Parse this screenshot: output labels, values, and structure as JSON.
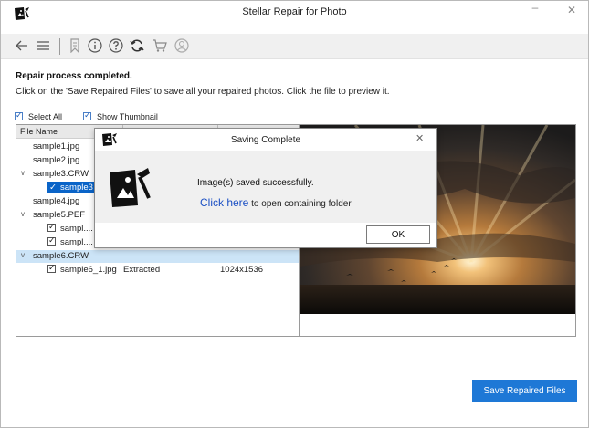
{
  "app": {
    "title": "Stellar Repair for Photo",
    "minimize": "–",
    "close": "✕"
  },
  "toolbar": {
    "icons": [
      "back-arrow-icon",
      "menu-icon",
      "bookmark-icon",
      "info-icon",
      "help-icon",
      "refresh-icon",
      "cart-icon",
      "user-icon"
    ]
  },
  "main": {
    "status": "Repair process completed.",
    "instruction": "Click on the 'Save Repaired Files' to save all your repaired photos. Click the file to preview it.",
    "select_all": "Select All",
    "show_thumbnail": "Show Thumbnail"
  },
  "file_list": {
    "header": {
      "file_name": "File Name"
    },
    "rows": [
      {
        "label": "sample1.jpg"
      },
      {
        "label": "sample2.jpg"
      },
      {
        "label": "sample3.CRW",
        "expander": "v"
      },
      {
        "label": "sample3"
      },
      {
        "label": "sample4.jpg"
      },
      {
        "label": "sample5.PEF",
        "expander": "v"
      },
      {
        "label": "sampl...."
      },
      {
        "label": "sampl...."
      },
      {
        "label": "sample6.CRW",
        "expander": "v"
      },
      {
        "label": "sample6_1.jpg",
        "status": "Extracted",
        "dimensions": "1024x1536"
      }
    ]
  },
  "save_button": "Save Repaired Files",
  "dialog": {
    "title": "Saving Complete",
    "close": "✕",
    "message": "Image(s) saved successfully.",
    "link_text": "Click here",
    "link_suffix": " to open containing folder.",
    "ok": "OK"
  },
  "colors": {
    "accent": "#1e78d6",
    "link": "#1a4fc4",
    "selection": "#cce4f7"
  }
}
